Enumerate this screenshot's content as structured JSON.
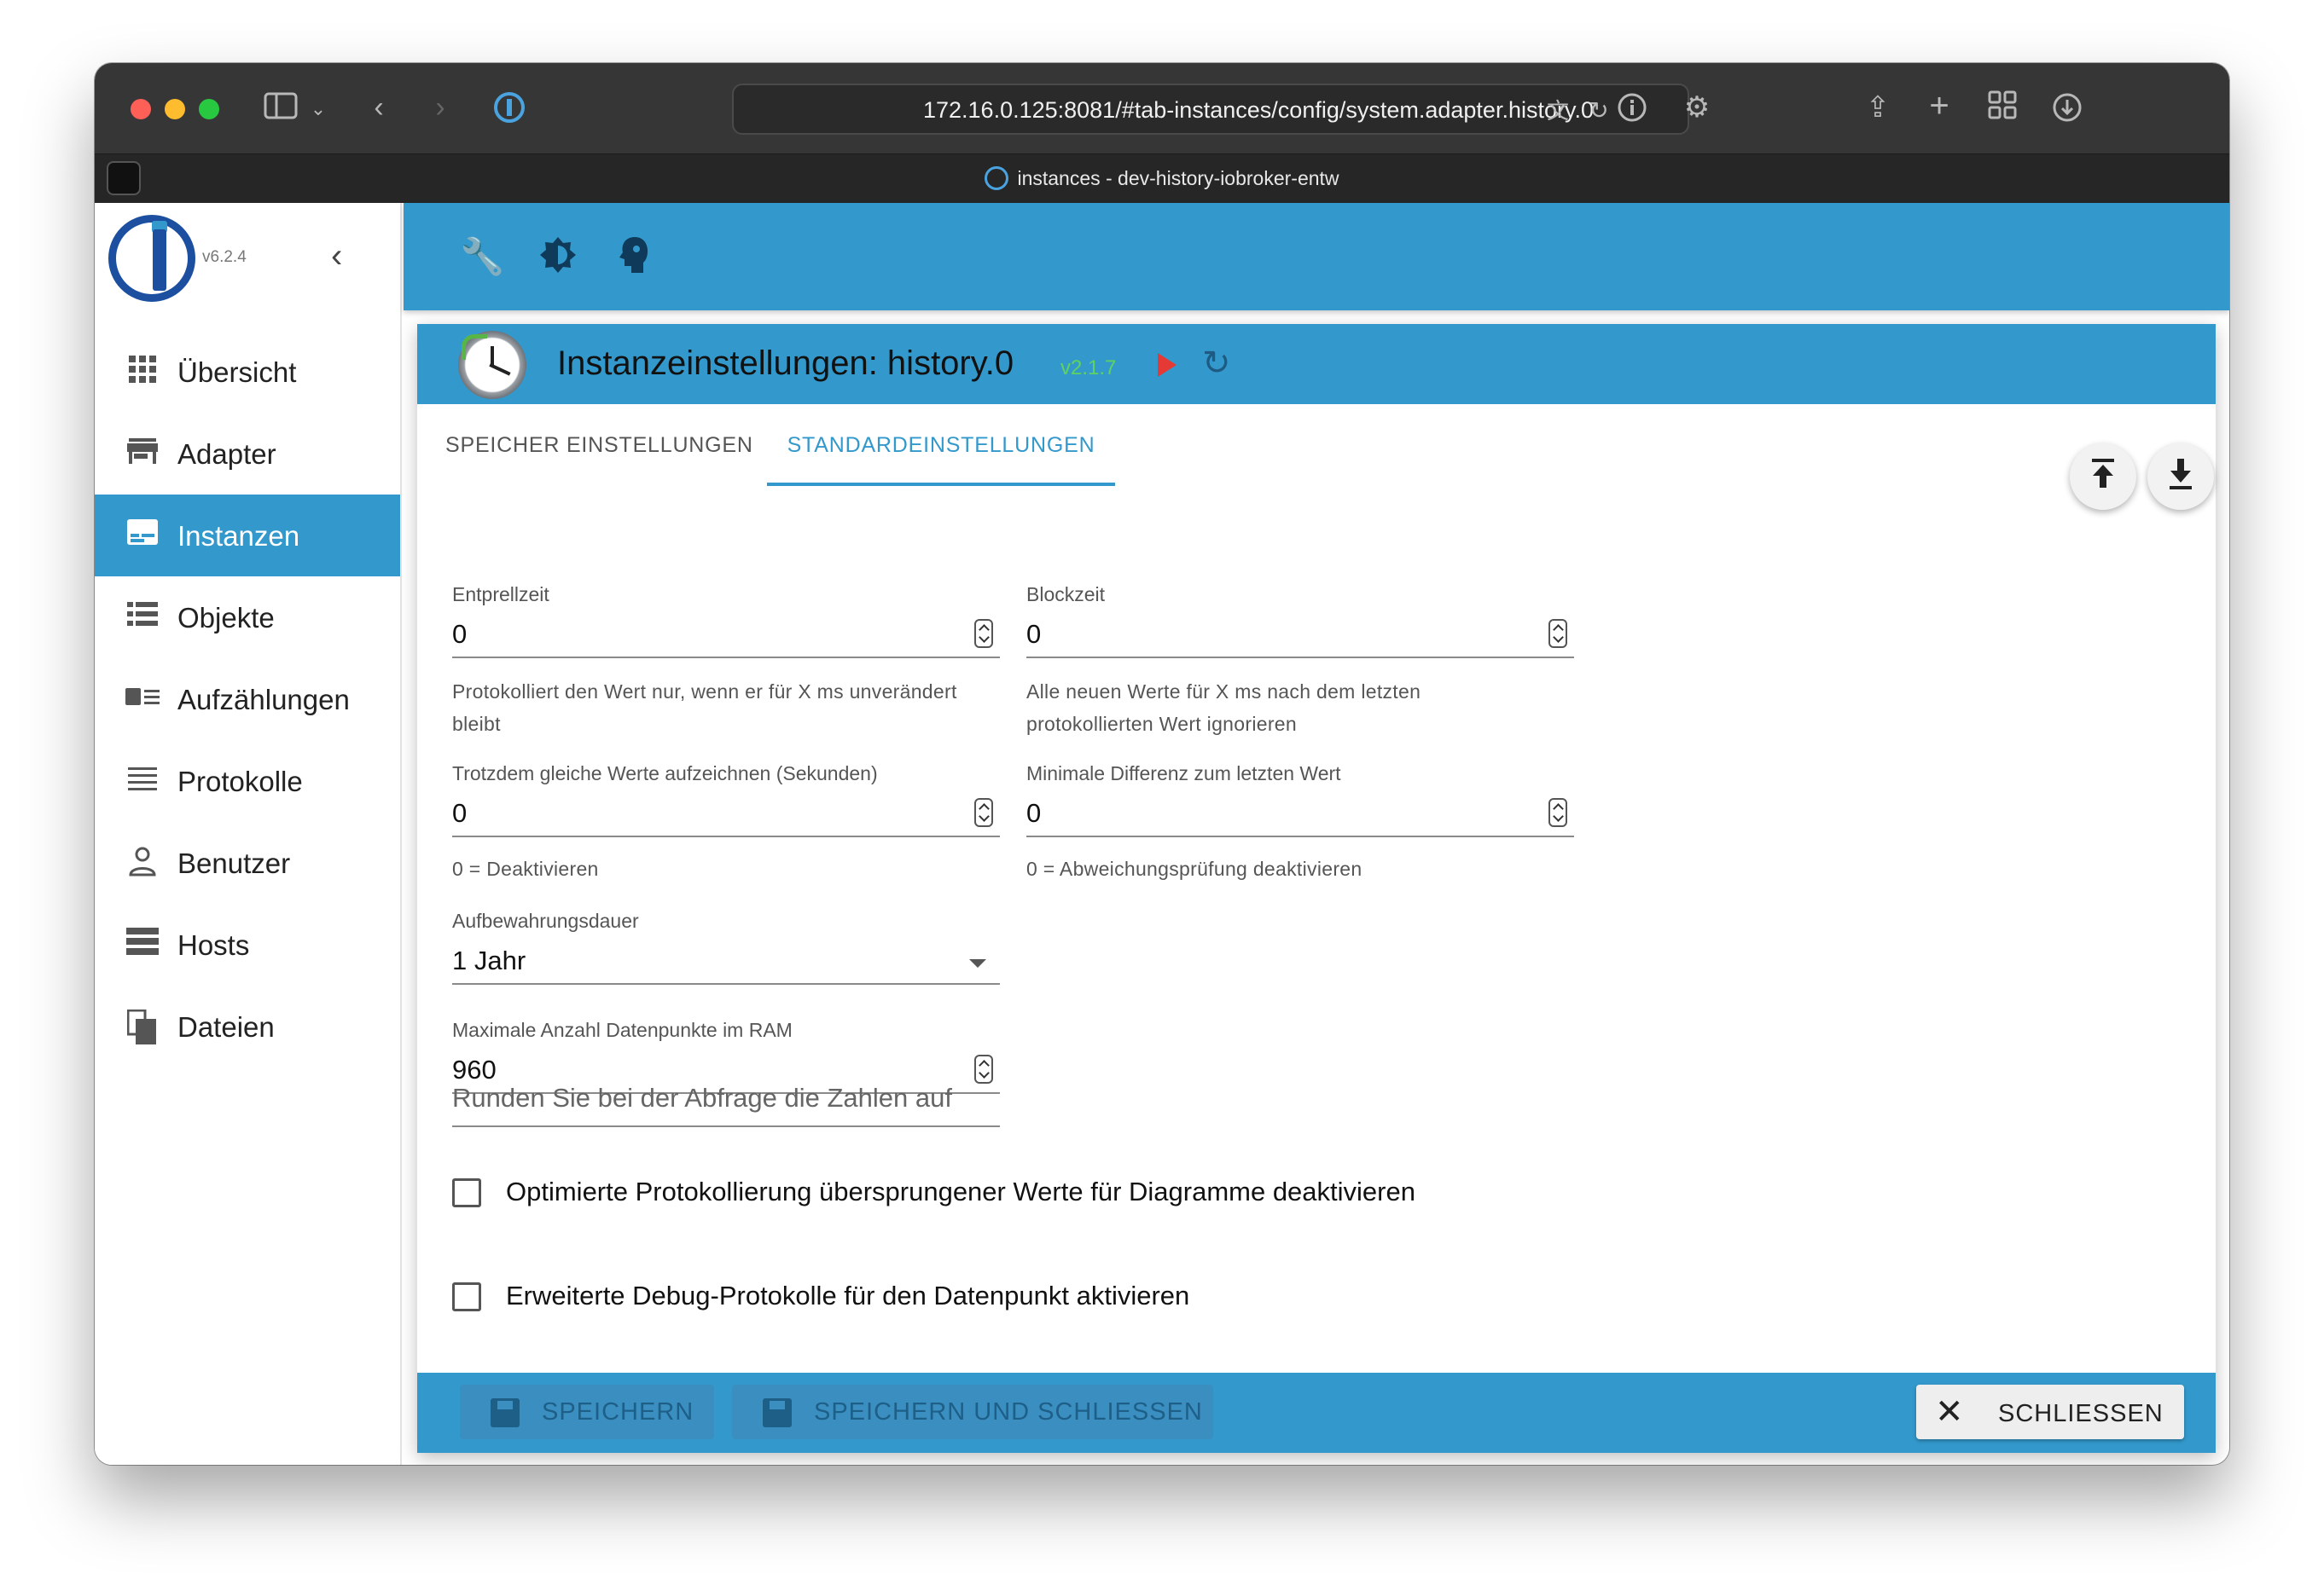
{
  "browser": {
    "url": "172.16.0.125:8081/#tab-instances/config/system.adapter.history.0",
    "tab_title": "instances - dev-history-iobroker-entw"
  },
  "sidebar": {
    "version": "v6.2.4",
    "items": [
      {
        "label": "Übersicht",
        "icon": "grid-icon",
        "active": false
      },
      {
        "label": "Adapter",
        "icon": "store-icon",
        "active": false
      },
      {
        "label": "Instanzen",
        "icon": "instances-icon",
        "active": true
      },
      {
        "label": "Objekte",
        "icon": "list-icon",
        "active": false
      },
      {
        "label": "Aufzählungen",
        "icon": "enums-icon",
        "active": false
      },
      {
        "label": "Protokolle",
        "icon": "logs-icon",
        "active": false
      },
      {
        "label": "Benutzer",
        "icon": "user-icon",
        "active": false
      },
      {
        "label": "Hosts",
        "icon": "hosts-icon",
        "active": false
      },
      {
        "label": "Dateien",
        "icon": "files-icon",
        "active": false
      }
    ]
  },
  "dialog": {
    "title": "Instanzeinstellungen: history.0",
    "version": "v2.1.7",
    "tabs": [
      "SPEICHER EINSTELLUNGEN",
      "STANDARDEINSTELLUNGEN"
    ],
    "active_tab": 1,
    "fields": {
      "entprellzeit": {
        "label": "Entprellzeit",
        "value": "0",
        "help": "Protokolliert den Wert nur, wenn er für X ms unverändert bleibt"
      },
      "blockzeit": {
        "label": "Blockzeit",
        "value": "0",
        "help": "Alle neuen Werte für X ms nach dem letzten protokollierten Wert ignorieren"
      },
      "gleiche_werte": {
        "label": "Trotzdem gleiche Werte aufzeichnen (Sekunden)",
        "value": "0",
        "help": "0 = Deaktivieren"
      },
      "min_diff": {
        "label": "Minimale Differenz zum letzten Wert",
        "value": "0",
        "help": "0 = Abweichungsprüfung deaktivieren"
      },
      "aufbewahrung": {
        "label": "Aufbewahrungsdauer",
        "value": "1 Jahr"
      },
      "max_ram": {
        "label": "Maximale Anzahl Datenpunkte im RAM",
        "value": "960"
      },
      "runden": {
        "placeholder": "Runden Sie bei der Abfrage die Zahlen auf"
      }
    },
    "checkboxes": [
      {
        "label": "Optimierte Protokollierung übersprungener Werte für Diagramme deaktivieren",
        "checked": false
      },
      {
        "label": "Erweiterte Debug-Protokolle für den Datenpunkt aktivieren",
        "checked": false
      }
    ],
    "buttons": {
      "save": "SPEICHERN",
      "save_close": "SPEICHERN UND SCHLIESSEN",
      "close": "SCHLIESSEN"
    }
  },
  "colors": {
    "accent": "#3399cc",
    "version_green": "#5fd35f",
    "play_red": "#e53935"
  }
}
